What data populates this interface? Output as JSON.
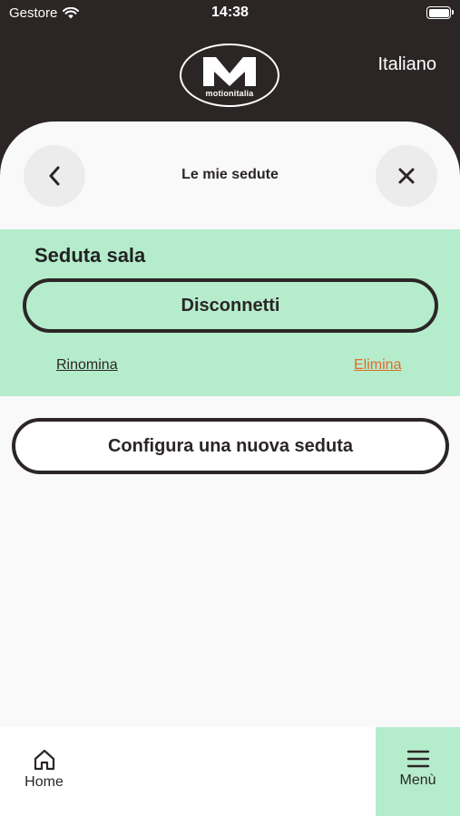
{
  "status_bar": {
    "carrier": "Gestore",
    "time": "14:38"
  },
  "header": {
    "logo_text": "motionitalia",
    "language": "Italiano"
  },
  "card": {
    "title": "Le mie sedute"
  },
  "session": {
    "name": "Seduta sala",
    "disconnect_label": "Disconnetti",
    "rename_label": "Rinomina",
    "delete_label": "Elimina"
  },
  "new_session_label": "Configura una nuova seduta",
  "tab_bar": {
    "home_label": "Home",
    "menu_label": "Menù"
  },
  "colors": {
    "header_bg": "#2b2625",
    "accent_green": "#b5eccc",
    "delete_orange": "#e06a2b"
  },
  "icons": {
    "back": "chevron-left-icon",
    "close": "close-icon",
    "home": "home-icon",
    "menu": "hamburger-icon",
    "wifi": "wifi-icon",
    "battery": "battery-icon"
  }
}
